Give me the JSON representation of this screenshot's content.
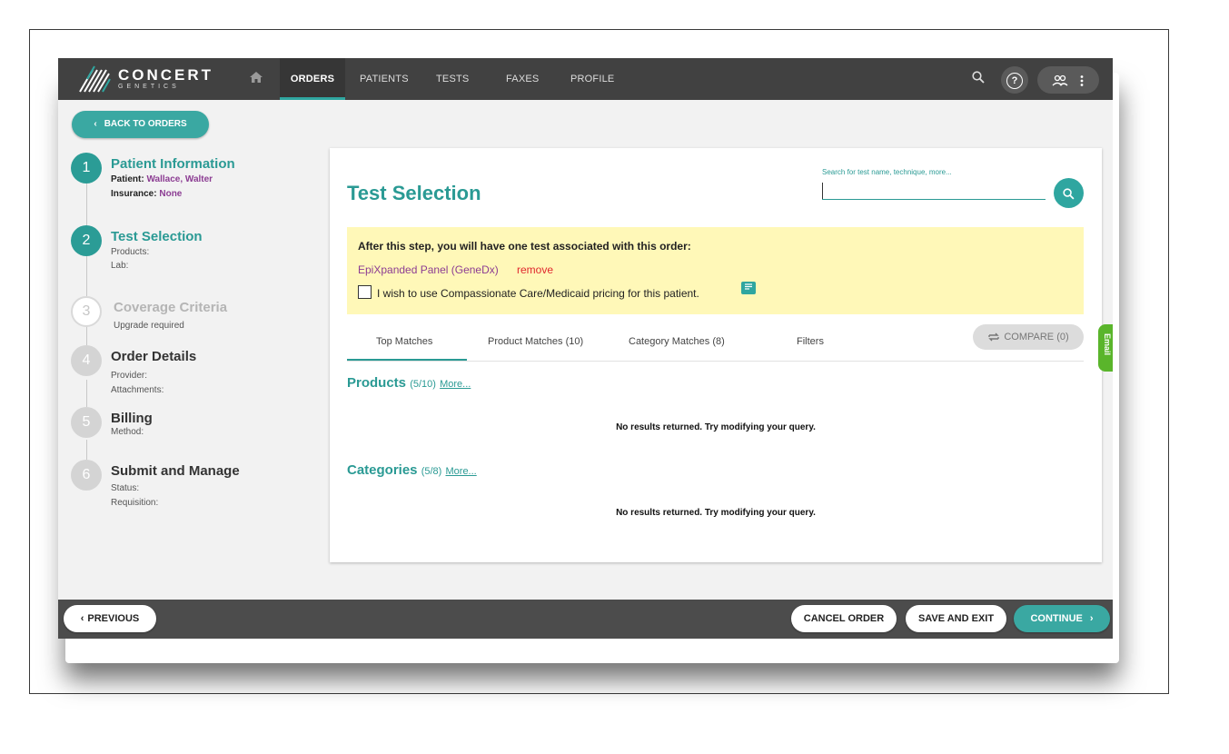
{
  "logo": {
    "name": "CONCERT",
    "sub": "GENETICS"
  },
  "nav": {
    "home_icon": "home-icon",
    "tabs": [
      {
        "label": "ORDERS",
        "active": true
      },
      {
        "label": "PATIENTS"
      },
      {
        "label": "TESTS"
      },
      {
        "label": "FAXES"
      },
      {
        "label": "PROFILE"
      }
    ],
    "help_glyph": "?"
  },
  "back_button": "BACK TO ORDERS",
  "steps": [
    {
      "num": "1",
      "title": "Patient Information",
      "lines": [
        {
          "label": "Patient:",
          "value": "Wallace, Walter"
        },
        {
          "label": "Insurance:",
          "value": "None"
        }
      ]
    },
    {
      "num": "2",
      "title": "Test Selection",
      "lines": [
        {
          "label": "Products:"
        },
        {
          "label": "Lab:"
        }
      ]
    },
    {
      "num": "3",
      "title": "Coverage Criteria",
      "lines": [
        {
          "label": "Upgrade required"
        }
      ]
    },
    {
      "num": "4",
      "title": "Order Details",
      "lines": [
        {
          "label": "Provider:"
        },
        {
          "label": "Attachments:"
        }
      ]
    },
    {
      "num": "5",
      "title": "Billing",
      "lines": [
        {
          "label": "Method:"
        }
      ]
    },
    {
      "num": "6",
      "title": "Submit and Manage",
      "lines": [
        {
          "label": "Status:"
        },
        {
          "label": "Requisition:"
        }
      ]
    }
  ],
  "card": {
    "title": "Test Selection",
    "search_label": "Search for test name, technique, more...",
    "search_value": "",
    "notice": {
      "heading": "After this step, you will have one test associated with this order:",
      "product": "EpiXpanded Panel (GeneDx)",
      "remove": "remove",
      "checkbox_label": "I wish to use Compassionate Care/Medicaid pricing for this patient.",
      "checked": false
    },
    "tabs": [
      "Top Matches",
      "Product Matches (10)",
      "Category Matches (8)",
      "Filters"
    ],
    "compare": "COMPARE (0)",
    "sections": [
      {
        "title": "Products",
        "count": "(5/10)",
        "more": "More...",
        "empty": "No results returned. Try modifying your query."
      },
      {
        "title": "Categories",
        "count": "(5/8)",
        "more": "More...",
        "empty": "No results returned. Try modifying your query."
      }
    ]
  },
  "email_tab": "Email",
  "footer": {
    "previous": "PREVIOUS",
    "cancel": "CANCEL ORDER",
    "save": "SAVE AND EXIT",
    "continue": "CONTINUE"
  },
  "colors": {
    "teal": "#2a9a94",
    "purple": "#8c3d93",
    "red": "#e0282e",
    "notice": "#fff8b8",
    "nav": "#414141"
  }
}
